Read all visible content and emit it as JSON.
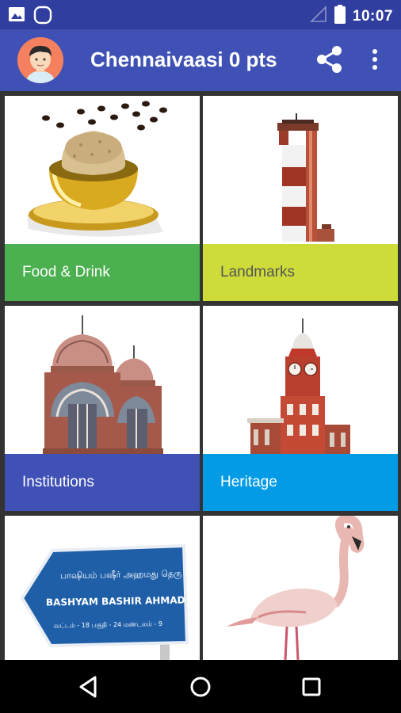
{
  "status_bar": {
    "time": "10:07",
    "icons": [
      "image-notification-icon",
      "app-notification-icon",
      "signal-icon",
      "battery-icon"
    ]
  },
  "app_bar": {
    "title": "Chennaivaasi 0 pts",
    "avatar": "avatar",
    "actions": [
      "share-icon",
      "overflow-menu-icon"
    ]
  },
  "categories": [
    {
      "label": "Food & Drink",
      "color": "#4caf50",
      "text_color": "#ffffff",
      "image": "filter-coffee"
    },
    {
      "label": "Landmarks",
      "color": "#cddc39",
      "text_color": "#555555",
      "image": "lighthouse"
    },
    {
      "label": "Institutions",
      "color": "#3f51b5",
      "text_color": "#ffffff",
      "image": "university-building"
    },
    {
      "label": "Heritage",
      "color": "#039be5",
      "text_color": "#ffffff",
      "image": "clock-tower"
    },
    {
      "label": "",
      "color": "#ffffff",
      "text_color": "#ffffff",
      "image": "street-sign"
    },
    {
      "label": "",
      "color": "#ffffff",
      "text_color": "#ffffff",
      "image": "flamingo"
    }
  ],
  "street_sign": {
    "tamil_line": "பாஷியம் பஷீர் அஹமது தெரு",
    "name": "BASHYAM BASHIR AHMAD ST",
    "numbers": "வட்டம் - 18   பகுதி - 24   மண்டலம் - 9"
  },
  "nav_bar": {
    "buttons": [
      "back-icon",
      "home-icon",
      "recents-icon"
    ]
  }
}
